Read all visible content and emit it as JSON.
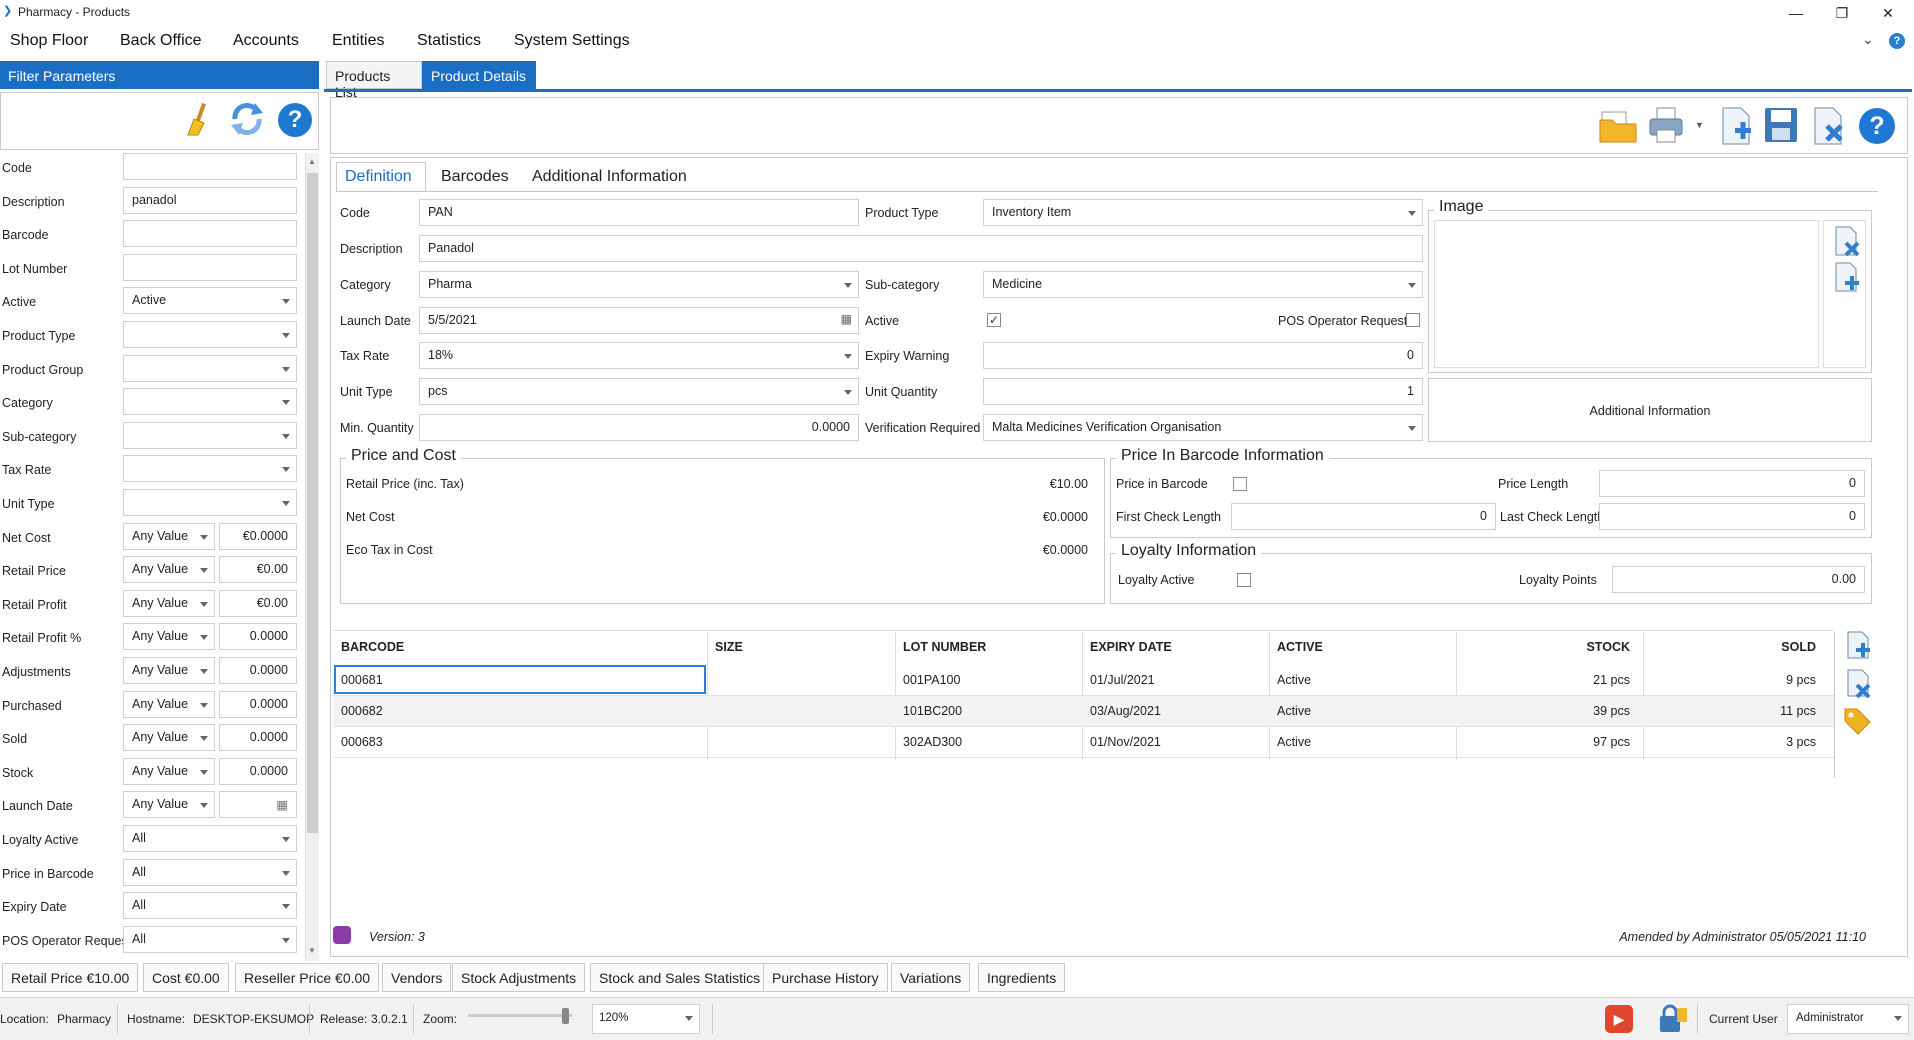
{
  "window": {
    "title": "Pharmacy - Products"
  },
  "menu": [
    "Shop Floor",
    "Back Office",
    "Accounts",
    "Entities",
    "Statistics",
    "System Settings"
  ],
  "filter": {
    "title": "Filter Parameters",
    "rows": [
      {
        "label": "Code",
        "value": ""
      },
      {
        "label": "Description",
        "value": "panadol"
      },
      {
        "label": "Barcode",
        "value": ""
      },
      {
        "label": "Lot Number",
        "value": ""
      },
      {
        "label": "Active",
        "value": "Active",
        "dd": true
      },
      {
        "label": "Product Type",
        "value": "",
        "dd": true
      },
      {
        "label": "Product Group",
        "value": "",
        "dd": true
      },
      {
        "label": "Category",
        "value": "",
        "dd": true
      },
      {
        "label": "Sub-category",
        "value": "",
        "dd": true
      },
      {
        "label": "Tax Rate",
        "value": "",
        "dd": true
      },
      {
        "label": "Unit Type",
        "value": "",
        "dd": true
      },
      {
        "label": "Net Cost",
        "op": "Any Value",
        "value": "€0.0000"
      },
      {
        "label": "Retail Price",
        "op": "Any Value",
        "value": "€0.00"
      },
      {
        "label": "Retail Profit",
        "op": "Any Value",
        "value": "€0.00"
      },
      {
        "label": "Retail Profit %",
        "op": "Any Value",
        "value": "0.0000"
      },
      {
        "label": "Adjustments",
        "op": "Any Value",
        "value": "0.0000"
      },
      {
        "label": "Purchased",
        "op": "Any Value",
        "value": "0.0000"
      },
      {
        "label": "Sold",
        "op": "Any Value",
        "value": "0.0000"
      },
      {
        "label": "Stock",
        "op": "Any Value",
        "value": "0.0000"
      },
      {
        "label": "Launch Date",
        "op": "Any Value",
        "value": ""
      },
      {
        "label": "Loyalty Active",
        "value": "All",
        "dd": true
      },
      {
        "label": "Price in Barcode",
        "value": "All",
        "dd": true
      },
      {
        "label": "Expiry Date",
        "value": "All",
        "dd": true
      },
      {
        "label": "POS Operator Request",
        "value": "All",
        "dd": true
      }
    ]
  },
  "tabs": [
    "Products List",
    "Product Details"
  ],
  "subtabs": [
    "Definition",
    "Barcodes",
    "Additional Information"
  ],
  "def": {
    "code_l": "Code",
    "code": "PAN",
    "ptype_l": "Product Type",
    "ptype": "Inventory Item",
    "desc_l": "Description",
    "desc": "Panadol",
    "cat_l": "Category",
    "cat": "Pharma",
    "subcat_l": "Sub-category",
    "subcat": "Medicine",
    "launch_l": "Launch Date",
    "launch": "5/5/2021",
    "active_l": "Active",
    "posreq_l": "POS Operator Request",
    "tax_l": "Tax Rate",
    "tax": "18%",
    "expw_l": "Expiry Warning",
    "expw": "0",
    "unit_l": "Unit Type",
    "unit": "pcs",
    "uqty_l": "Unit Quantity",
    "uqty": "1",
    "minq_l": "Min. Quantity",
    "minq": "0.0000",
    "verif_l": "Verification Required",
    "verif": "Malta Medicines Verification Organisation",
    "image_l": "Image",
    "addinfo": "Additional Information"
  },
  "price": {
    "title": "Price and Cost",
    "rows": [
      {
        "label": "Retail Price (inc. Tax)",
        "value": "€10.00"
      },
      {
        "label": "Net Cost",
        "value": "€0.0000"
      },
      {
        "label": "Eco Tax in Cost",
        "value": "€0.0000"
      }
    ]
  },
  "barcodeinfo": {
    "title": "Price In Barcode Information",
    "pib": "Price in Barcode",
    "plen_l": "Price Length",
    "plen": "0",
    "fcl_l": "First Check Length",
    "fcl": "0",
    "lcl_l": "Last Check Length",
    "lcl": "0"
  },
  "loyalty": {
    "title": "Loyalty Information",
    "active_l": "Loyalty Active",
    "points_l": "Loyalty Points",
    "points": "0.00"
  },
  "grid": {
    "headers": [
      "BARCODE",
      "SIZE",
      "LOT NUMBER",
      "EXPIRY DATE",
      "ACTIVE",
      "STOCK",
      "SOLD"
    ],
    "rows": [
      [
        "000681",
        "",
        "001PA100",
        "01/Jul/2021",
        "Active",
        "21 pcs",
        "9 pcs"
      ],
      [
        "000682",
        "",
        "101BC200",
        "03/Aug/2021",
        "Active",
        "39 pcs",
        "11 pcs"
      ],
      [
        "000683",
        "",
        "302AD300",
        "01/Nov/2021",
        "Active",
        "97 pcs",
        "3 pcs"
      ]
    ]
  },
  "version": "Version: 3",
  "amended": "Amended by Administrator 05/05/2021 11:10",
  "bottomtabs": [
    "Retail Price  €10.00",
    "Cost  €0.00",
    "Reseller Price  €0.00",
    "Vendors",
    "Stock Adjustments",
    "Stock and Sales Statistics",
    "Purchase History",
    "Variations",
    "Ingredients"
  ],
  "status": {
    "location_l": "Location:",
    "location": "Pharmacy",
    "host_l": "Hostname:",
    "host": "DESKTOP-EKSUMOP",
    "rel_l": "Release:",
    "rel": "3.0.2.1",
    "zoom_l": "Zoom:",
    "zoom": "120%",
    "user_l": "Current User",
    "user": "Administrator"
  },
  "colors": {
    "accent": "#1a6fc4"
  }
}
